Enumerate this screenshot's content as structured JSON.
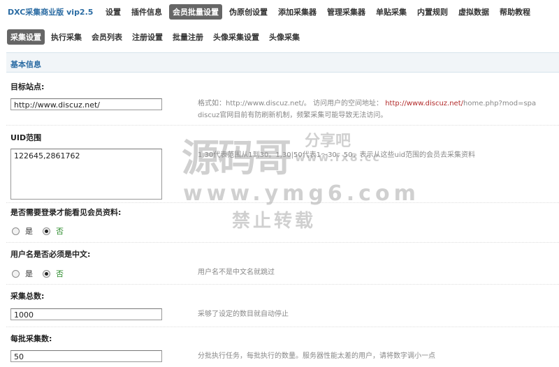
{
  "brand": "DXC采集商业版 vip2.5",
  "main_tabs": [
    {
      "label": "设置",
      "active": false
    },
    {
      "label": "插件信息",
      "active": false
    },
    {
      "label": "会员批量设置",
      "active": true
    },
    {
      "label": "伪原创设置",
      "active": false
    },
    {
      "label": "添加采集器",
      "active": false
    },
    {
      "label": "管理采集器",
      "active": false
    },
    {
      "label": "单贴采集",
      "active": false
    },
    {
      "label": "内置规则",
      "active": false
    },
    {
      "label": "虚拟数据",
      "active": false
    },
    {
      "label": "帮助教程",
      "active": false
    }
  ],
  "sub_tabs": [
    {
      "label": "采集设置",
      "active": true
    },
    {
      "label": "执行采集",
      "active": false
    },
    {
      "label": "会员列表",
      "active": false
    },
    {
      "label": "注册设置",
      "active": false
    },
    {
      "label": "批量注册",
      "active": false
    },
    {
      "label": "头像采集设置",
      "active": false
    },
    {
      "label": "头像采集",
      "active": false
    }
  ],
  "section_title": "基本信息",
  "fields": {
    "target_site": {
      "label": "目标站点:",
      "value": "http://www.discuz.net/",
      "hint_prefix": "格式如：http://www.discuz.net/。 访问用户的空间地址：",
      "hint_link": "http://www.discuz.net/",
      "hint_suffix": "home.php?mod=spa",
      "hint_line2": "discuz官网目前有防刷新机制，频繁采集可能导致无法访问。"
    },
    "uid_range": {
      "label": "UID范围",
      "value": "122645,2861762",
      "hint": "1,30代表范围从1到30。1,30|50代表1～30、50，表示从这些uid范围的会员去采集资料"
    },
    "need_login": {
      "label": "是否需要登录才能看见会员资料:",
      "options": [
        "是",
        "否"
      ],
      "selected": "否"
    },
    "username_chinese": {
      "label": "用户名是否必须是中文:",
      "options": [
        "是",
        "否"
      ],
      "selected": "否",
      "hint": "用户名不是中文名就跳过"
    },
    "total_count": {
      "label": "采集总数:",
      "value": "1000",
      "hint": "采够了设定的数目就自动停止"
    },
    "batch_count": {
      "label": "每批采集数:",
      "value": "50",
      "hint": "分批执行任务，每批执行的数量。服务器性能太差的用户，请将数字调小一点"
    }
  },
  "watermark": {
    "line1": "源码哥",
    "line1_side": "分享吧",
    "line1_url": "www.fx8.cc",
    "line2": "www.ymg6.com",
    "line3": "禁止转载"
  }
}
